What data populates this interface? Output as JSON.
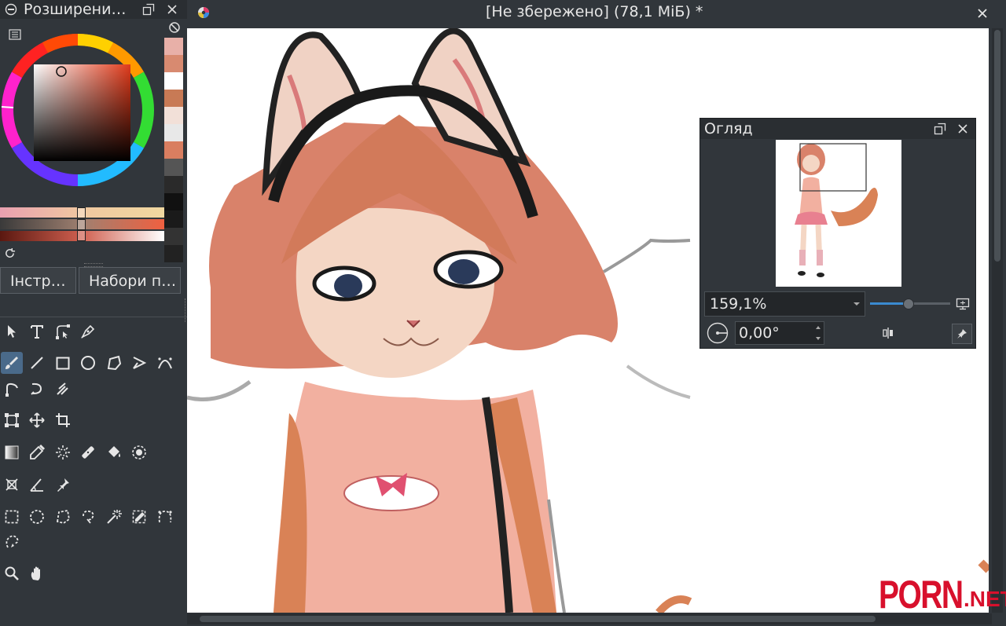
{
  "color_docker": {
    "title": "Розширени…"
  },
  "swatches": [
    "#e8b0a8",
    "#d88a70",
    "#ffffff",
    "#c87a55",
    "#f2e0d8",
    "#e8e8e8",
    "#d97e60",
    "#555555",
    "#2a2a2a",
    "#111111",
    "#1a1a1a",
    "#333333",
    "#222222"
  ],
  "tabs": {
    "tools": "Інстр…",
    "presets": "Набори п…"
  },
  "document": {
    "title": "[Не збережено]  (78,1 МіБ) *"
  },
  "overview": {
    "title": "Огляд",
    "zoom": "159,1%",
    "rotation": "0,00°"
  },
  "watermark": {
    "brand": "PORN",
    "suffix": ".NET"
  }
}
